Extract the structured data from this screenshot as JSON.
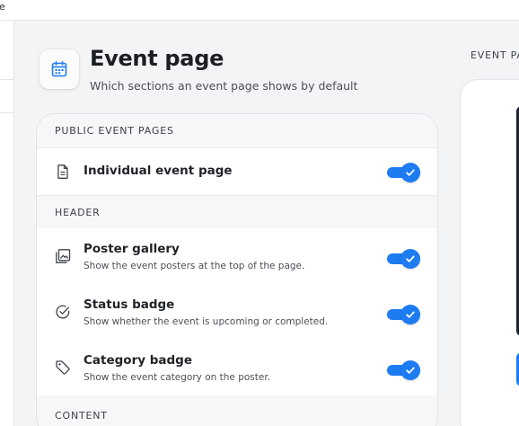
{
  "topbar": {
    "fragment": "e"
  },
  "header": {
    "icon": "calendar-icon",
    "title": "Event page",
    "subtitle": "Which sections an event page shows by default"
  },
  "sections": {
    "public": {
      "label": "PUBLIC EVENT PAGES"
    },
    "header": {
      "label": "HEADER"
    },
    "content": {
      "label": "CONTENT"
    }
  },
  "rows": {
    "individual": {
      "icon": "document-icon",
      "title": "Individual event page",
      "enabled": true
    },
    "poster_gallery": {
      "icon": "gallery-icon",
      "title": "Poster gallery",
      "description": "Show the event posters at the top of the page.",
      "enabled": true
    },
    "status_badge": {
      "icon": "check-circle-icon",
      "title": "Status badge",
      "description": "Show whether the event is upcoming or completed.",
      "enabled": true
    },
    "category_badge": {
      "icon": "tag-icon",
      "title": "Category badge",
      "description": "Show the event category on the poster.",
      "enabled": true
    }
  },
  "preview": {
    "label": "EVENT PAGE"
  },
  "colors": {
    "accent": "#1d7cf2",
    "background": "#f3f4f6",
    "card": "#ffffff"
  }
}
